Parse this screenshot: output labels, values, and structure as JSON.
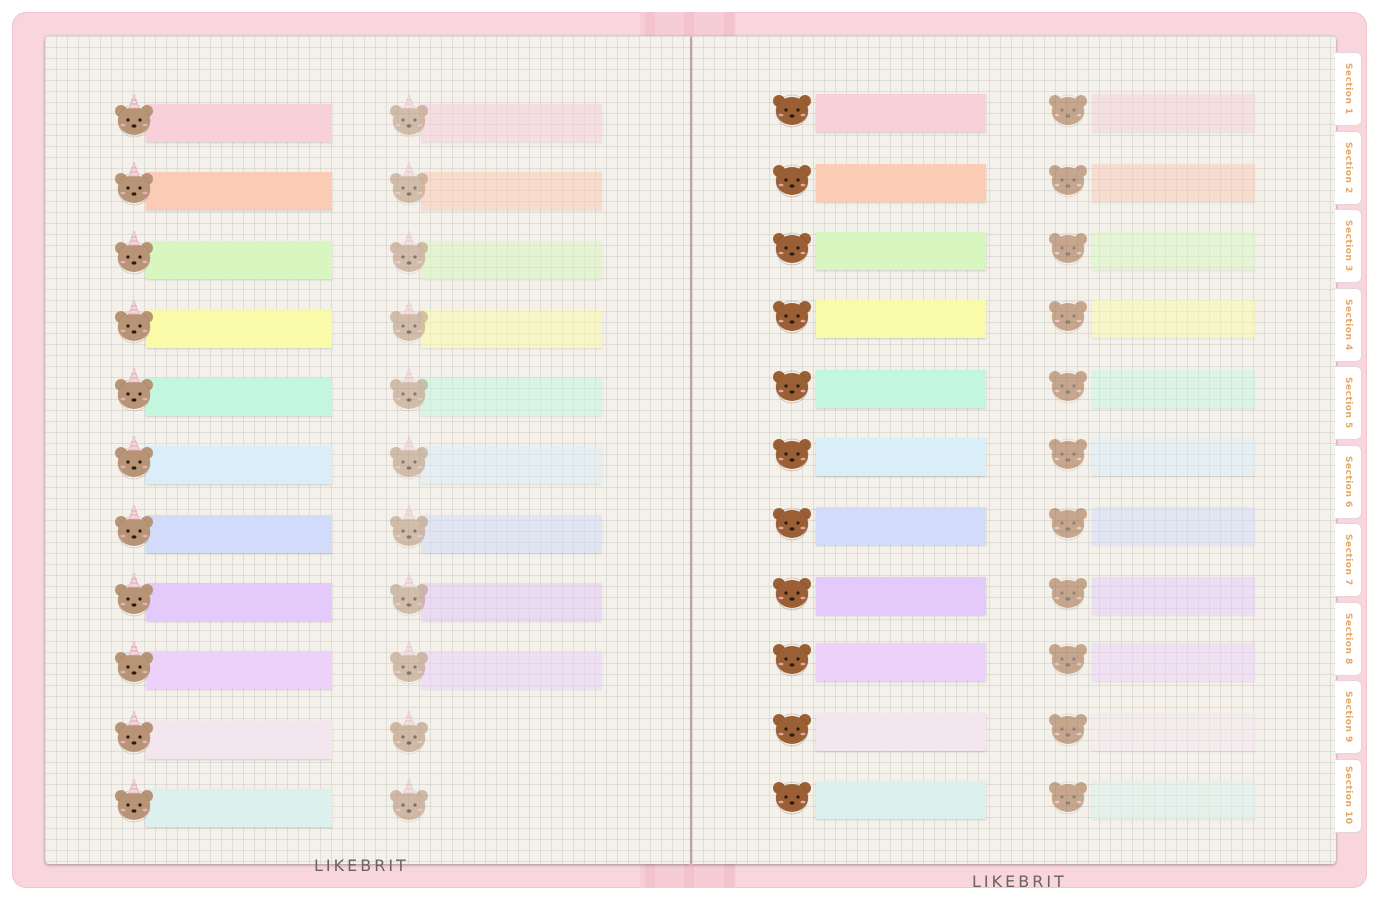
{
  "brand": "LIKEBRIT",
  "tabs": [
    "Section 1",
    "Section 2",
    "Section 3",
    "Section 4",
    "Section 5",
    "Section 6",
    "Section 7",
    "Section 8",
    "Section 9",
    "Section 10"
  ],
  "colors": {
    "cover": "#f9d6de",
    "page": "#f4f1ea",
    "bear_light": "#b89477",
    "bear_dark": "#9a5f34",
    "tab_text": "#e4a866"
  },
  "label_colors": [
    "#f7d0da",
    "#fbcbb5",
    "#d8f7c0",
    "#fafba9",
    "#c3f7dd",
    "#d9eef8",
    "#d2dcfa",
    "#e3cafa",
    "#ecd2fb",
    "#f3e6ee",
    "#dcf1ee"
  ],
  "left_page": {
    "bear_icon": "party-hat-bear-icon",
    "rows": 11,
    "faded_column_rows": 9
  },
  "right_page": {
    "bear_icon": "bear-face-icon",
    "rows": 11
  }
}
